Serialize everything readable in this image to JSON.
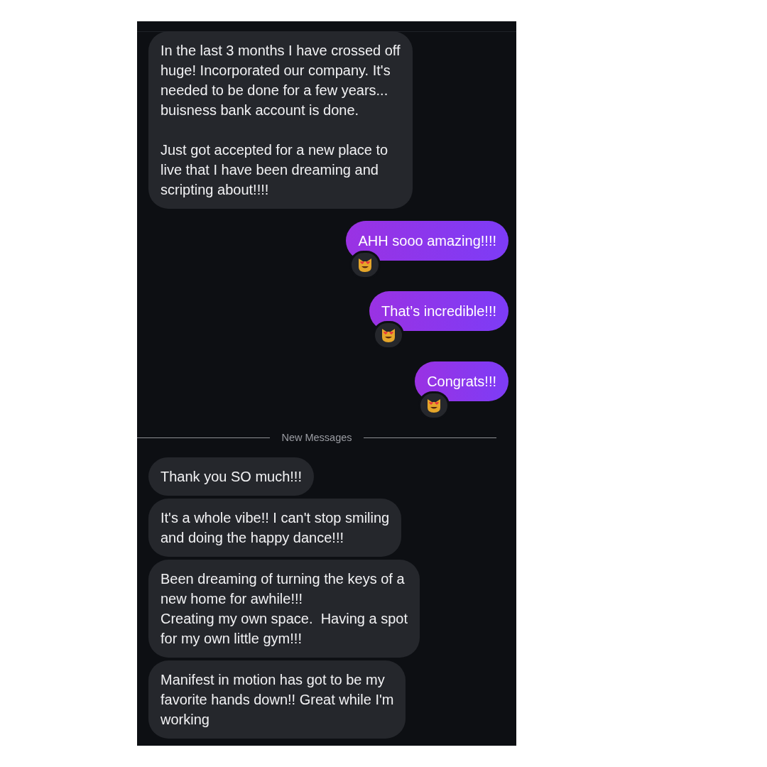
{
  "messages": [
    {
      "kind": "incoming",
      "paragraphs": [
        [
          "In the last 3 months I have crossed off",
          "huge! Incorporated our company. It's",
          "needed to be done for a few years...",
          "buisness bank account is done."
        ],
        [
          "Just got accepted for a new place to",
          "live that I have been dreaming and",
          "scripting about!!!!"
        ]
      ]
    },
    {
      "kind": "outgoing",
      "paragraphs": [
        [
          "AHH sooo amazing!!!!"
        ]
      ],
      "reacted": true
    },
    {
      "kind": "outgoing",
      "paragraphs": [
        [
          "That’s incredible!!!"
        ]
      ],
      "reacted": true
    },
    {
      "kind": "outgoing",
      "paragraphs": [
        [
          "Congrats!!!"
        ]
      ],
      "reacted": true
    }
  ],
  "divider": {
    "label": "New Messages"
  },
  "new_messages": [
    {
      "kind": "incoming",
      "paragraphs": [
        [
          "Thank you SO much!!!"
        ]
      ]
    },
    {
      "kind": "incoming",
      "paragraphs": [
        [
          "It's a whole vibe!! I can't stop smiling",
          "and doing the happy dance!!!"
        ]
      ]
    },
    {
      "kind": "incoming",
      "paragraphs": [
        [
          "Been dreaming of turning the keys of a",
          "new home for awhile!!!",
          "Creating my own space.  Having a spot",
          "for my own little gym!!!"
        ]
      ]
    },
    {
      "kind": "incoming",
      "paragraphs": [
        [
          "Manifest in motion has got to be my",
          "favorite hands down!! Great while I'm",
          "working"
        ]
      ]
    }
  ]
}
